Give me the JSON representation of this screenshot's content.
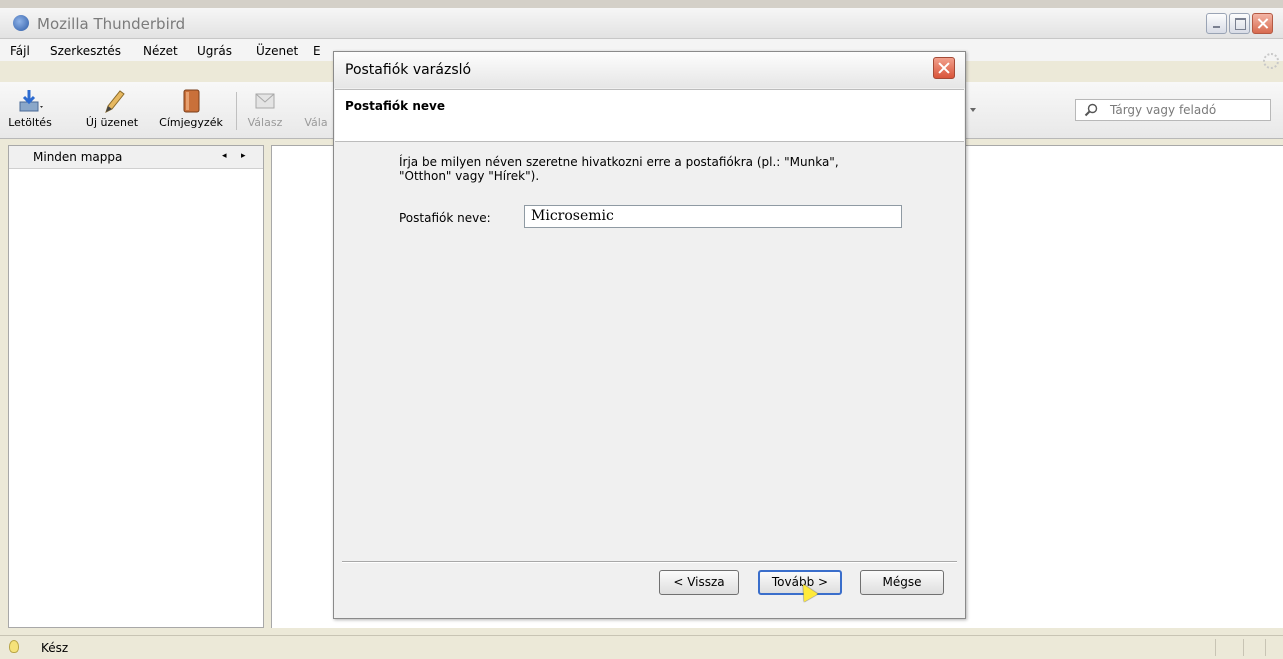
{
  "window": {
    "title": "Mozilla Thunderbird"
  },
  "menu": {
    "items": [
      {
        "label": "Fájl"
      },
      {
        "label": "Szerkesztés"
      },
      {
        "label": "Nézet"
      },
      {
        "label": "Ugrás"
      },
      {
        "label": "Üzenet"
      },
      {
        "label": "E"
      }
    ]
  },
  "toolbar": {
    "download_label": "Letöltés",
    "new_message_label": "Új üzenet",
    "address_book_label": "Címjegyzék",
    "reply_label": "Válasz",
    "reply_all_label": "Vála"
  },
  "search": {
    "placeholder": "Tárgy vagy feladó"
  },
  "folder_pane": {
    "title": "Minden mappa",
    "nav_prev": "◂",
    "nav_next": "▸"
  },
  "status": {
    "text": "Kész"
  },
  "dialog": {
    "title": "Postafiók varázsló",
    "heading": "Postafiók neve",
    "description": "Írja be milyen néven szeretne hivatkozni erre a postafiókra (pl.: \"Munka\", \"Otthon\" vagy \"Hírek\").",
    "field_label": "Postafiók neve:",
    "field_value": "Microsemic",
    "back_button": "< Vissza",
    "next_button": "Tovább >",
    "cancel_button": "Mégse"
  },
  "colors": {
    "chrome": "#ece9d8",
    "dialog_bg": "#f0f0f0",
    "close_red": "#d9543a",
    "focus_blue": "#3a6ecb"
  }
}
